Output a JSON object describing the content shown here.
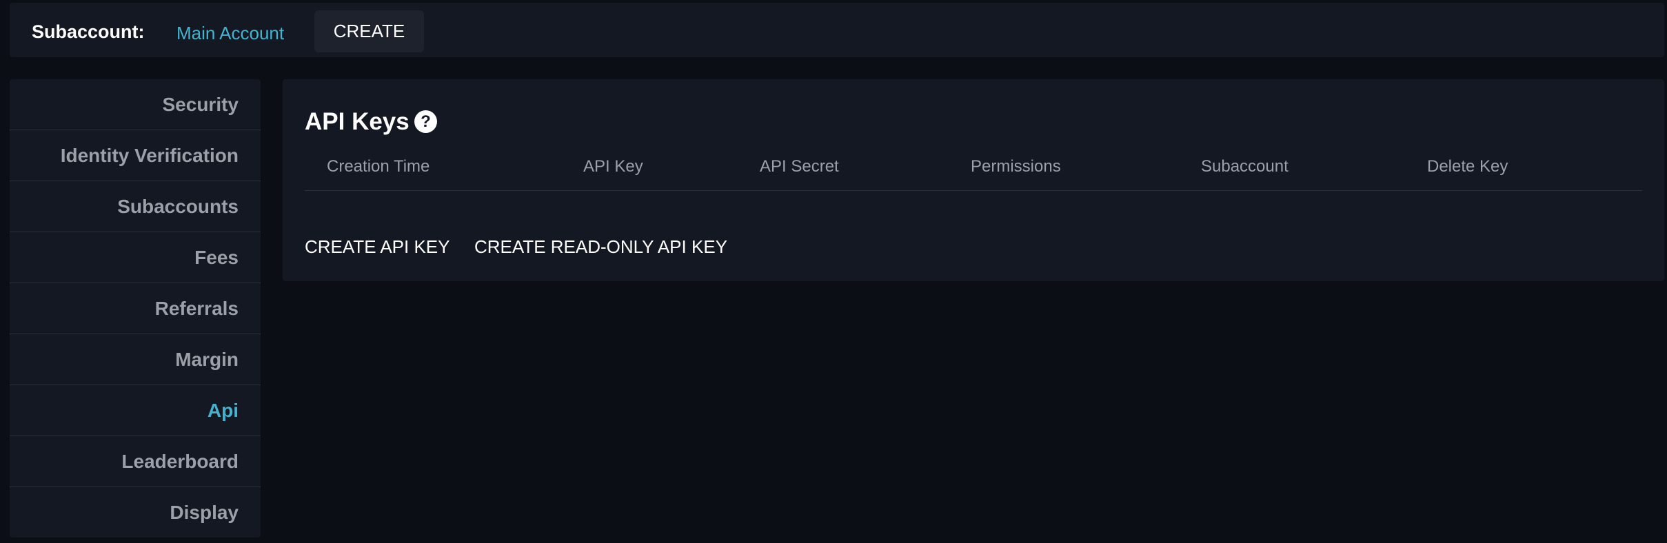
{
  "topbar": {
    "subaccount_label": "Subaccount:",
    "current_account": "Main Account",
    "create_label": "CREATE"
  },
  "colors": {
    "accent": "#45b3ce",
    "background": "#0b0e15",
    "panel": "#131822",
    "text_muted": "#9ca0a8"
  },
  "sidebar": {
    "items": [
      {
        "label": "Security",
        "active": false
      },
      {
        "label": "Identity Verification",
        "active": false
      },
      {
        "label": "Subaccounts",
        "active": false
      },
      {
        "label": "Fees",
        "active": false
      },
      {
        "label": "Referrals",
        "active": false
      },
      {
        "label": "Margin",
        "active": false
      },
      {
        "label": "Api",
        "active": true
      },
      {
        "label": "Leaderboard",
        "active": false
      },
      {
        "label": "Display",
        "active": false
      }
    ]
  },
  "api_keys": {
    "title": "API Keys",
    "help_icon": "question-circle-icon",
    "columns": [
      "Creation Time",
      "API Key",
      "API Secret",
      "Permissions",
      "Subaccount",
      "Delete Key"
    ],
    "rows": [],
    "create_api_key_label": "CREATE API KEY",
    "create_readonly_api_key_label": "CREATE READ-ONLY API KEY"
  }
}
